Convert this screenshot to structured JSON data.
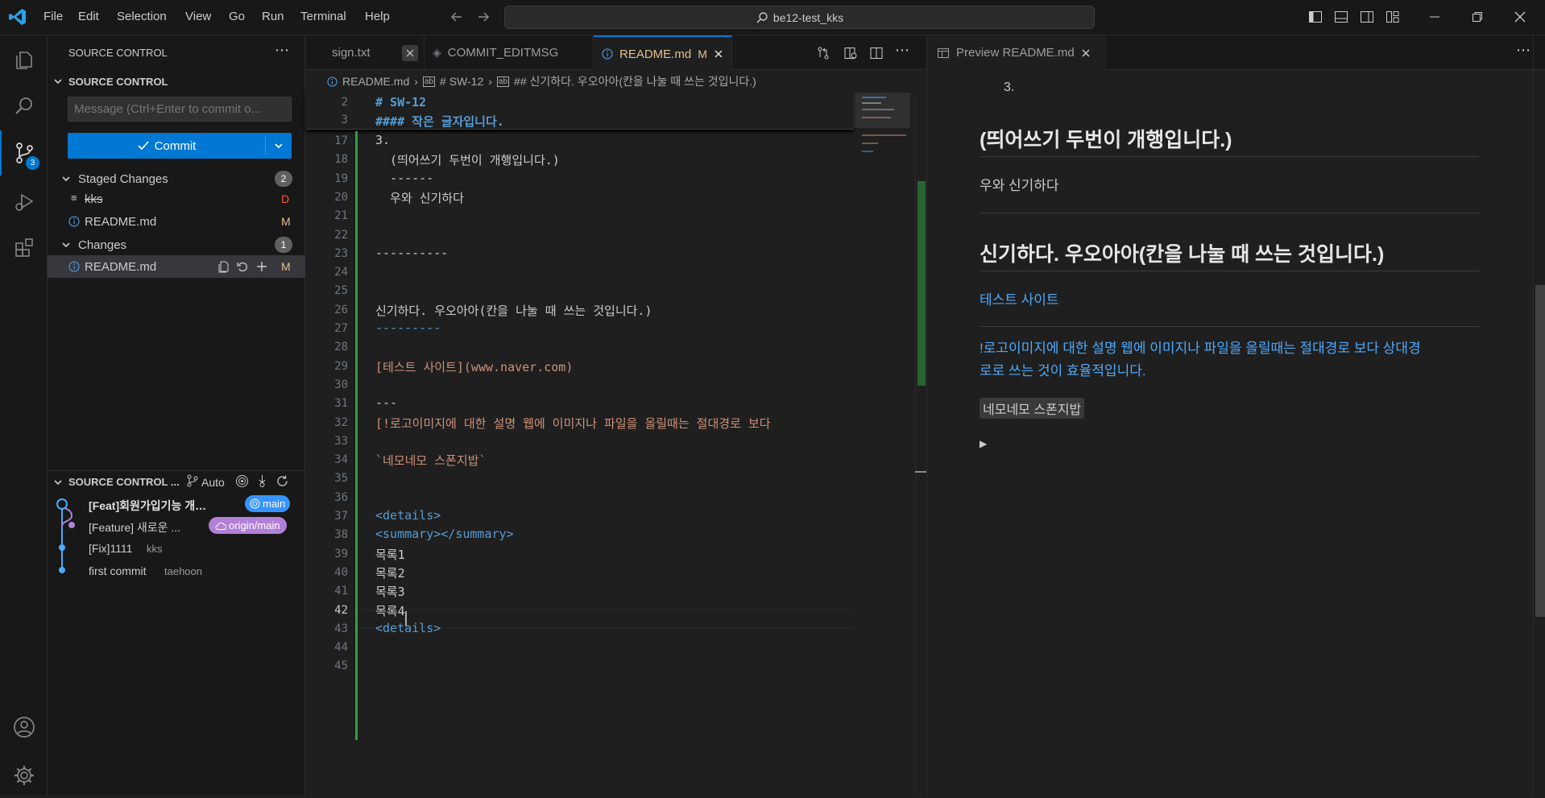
{
  "menu": [
    "File",
    "Edit",
    "Selection",
    "View",
    "Go",
    "Run",
    "Terminal",
    "Help"
  ],
  "title": {
    "search": "be12-test_kks"
  },
  "sidebar": {
    "header": "SOURCE CONTROL",
    "section": "SOURCE CONTROL",
    "message_placeholder": "Message (Ctrl+Enter to commit o...",
    "commit_label": "Commit",
    "staged": {
      "label": "Staged Changes",
      "count": "2",
      "files": [
        {
          "name": "kks",
          "status": "D"
        },
        {
          "name": "README.md",
          "status": "M"
        }
      ]
    },
    "changes": {
      "label": "Changes",
      "count": "1",
      "files": [
        {
          "name": "README.md",
          "status": "M"
        }
      ]
    },
    "graph": {
      "header": "SOURCE CONTROL ...",
      "auto": "Auto",
      "commits": [
        {
          "message": "[Feat]회원가입기능 개발...",
          "author": "",
          "ref": "main"
        },
        {
          "message": "[Feature] 새로운 ...",
          "author": "",
          "ref": "origin/main"
        },
        {
          "message": "[Fix]1111",
          "author": "kks",
          "ref": ""
        },
        {
          "message": "first commit",
          "author": "taehoon",
          "ref": ""
        }
      ]
    },
    "scm_badge": "3"
  },
  "tabs": [
    {
      "label": "sign.txt",
      "modified": ""
    },
    {
      "label": "COMMIT_EDITMSG",
      "modified": ""
    },
    {
      "label": "README.md",
      "modified": "M"
    }
  ],
  "breadcrumb": {
    "file": "README.md",
    "h1": "# SW-12",
    "h2": "## 신기하다. 우오아아(칸을 나눌 때 쓰는 것입니다.)"
  },
  "editor": {
    "sticky": [
      {
        "n": "2",
        "text": "# SW-12"
      },
      {
        "n": "3",
        "text": "#### 작은 글자입니다."
      }
    ],
    "lines": [
      {
        "n": "17",
        "text": "3."
      },
      {
        "n": "18",
        "text": "  (띄어쓰기 두번이 개행입니다.)"
      },
      {
        "n": "19",
        "text": "  ------"
      },
      {
        "n": "20",
        "text": "  우와 신기하다"
      },
      {
        "n": "21",
        "text": ""
      },
      {
        "n": "22",
        "text": ""
      },
      {
        "n": "23",
        "text": "----------"
      },
      {
        "n": "24",
        "text": ""
      },
      {
        "n": "25",
        "text": ""
      },
      {
        "n": "26",
        "text": "신기하다. 우오아아(칸을 나눌 때 쓰는 것입니다.)"
      },
      {
        "n": "27",
        "text": "---------"
      },
      {
        "n": "28",
        "text": ""
      },
      {
        "n": "29",
        "text": "[테스트 사이트](www.naver.com)"
      },
      {
        "n": "30",
        "text": ""
      },
      {
        "n": "31",
        "text": "---"
      },
      {
        "n": "32",
        "text": "[!로고이미지에 대한 설명 웹에 이미지나 파일을 올릴때는 절대경로 보다"
      },
      {
        "n": "33",
        "text": ""
      },
      {
        "n": "34",
        "text": "`네모네모 스폰지밥`"
      },
      {
        "n": "35",
        "text": ""
      },
      {
        "n": "36",
        "text": ""
      },
      {
        "n": "37",
        "text": "<details>"
      },
      {
        "n": "38",
        "text": "<summary></summary>"
      },
      {
        "n": "39",
        "text": "목록1"
      },
      {
        "n": "40",
        "text": "목록2"
      },
      {
        "n": "41",
        "text": "목록3"
      },
      {
        "n": "42",
        "text": "목록4"
      },
      {
        "n": "43",
        "text": "<details>"
      },
      {
        "n": "44",
        "text": ""
      },
      {
        "n": "45",
        "text": ""
      }
    ]
  },
  "preview": {
    "tab": "Preview README.md",
    "list_marker": "3.",
    "heading1": "(띄어쓰기 두번이 개행입니다.)",
    "para1": "우와 신기하다",
    "heading2": "신기하다. 우오아아(칸을 나눌 때 쓰는 것입니다.)",
    "link": "테스트 사이트",
    "image_alt_line1": "!로고이미지에 대한 설명 웹에 이미지나 파일을 올릴때는 절대경로 보다 상대경",
    "image_alt_line2": "로로 쓰는 것이 효율적입니다.",
    "code": "네모네모 스폰지밥"
  },
  "colors": {
    "accent": "#0078d4",
    "link": "#4daafc",
    "heading": "#569cd6",
    "string": "#ce9178",
    "added": "#2ea043",
    "deleted": "#f85149",
    "modified": "#e2c08d"
  }
}
